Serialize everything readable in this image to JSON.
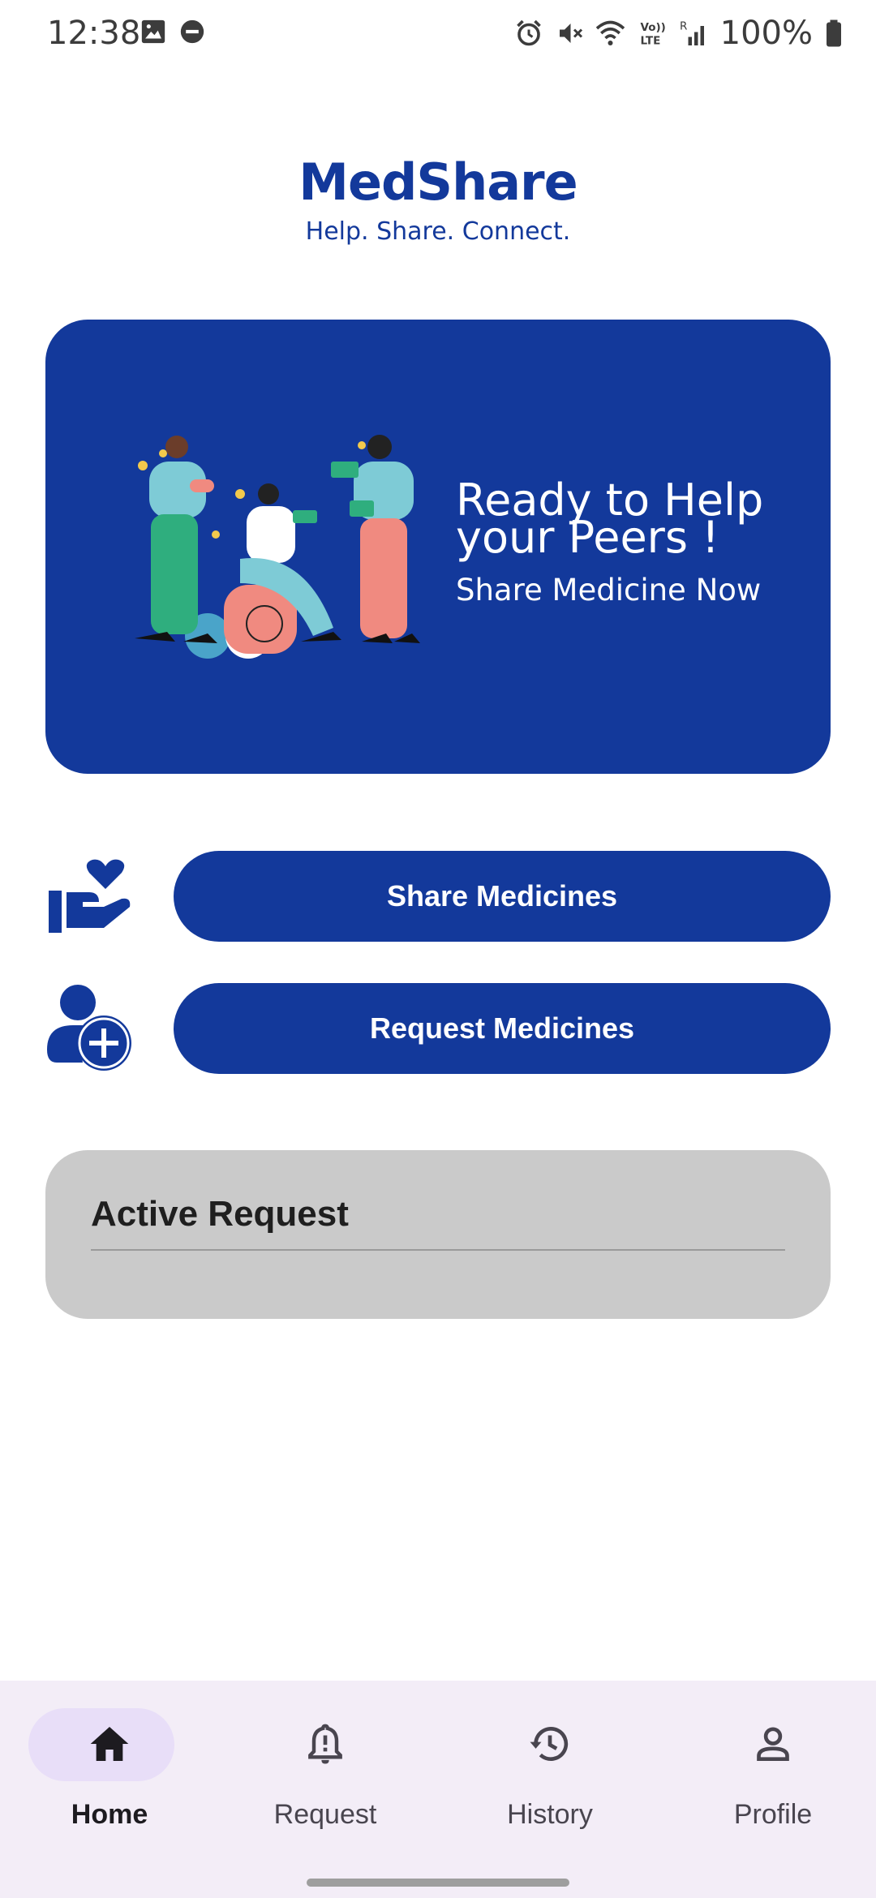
{
  "status_bar": {
    "time": "12:38",
    "battery": "100%",
    "icons": [
      "image-icon",
      "dnd-icon",
      "alarm-icon",
      "mute-icon",
      "wifi-icon",
      "volte-icon",
      "signal-icon",
      "battery-icon"
    ]
  },
  "header": {
    "app_name": "MedShare",
    "tagline": "Help. Share. Connect."
  },
  "hero": {
    "heading": "Ready to Help your Peers !",
    "subheading": "Share Medicine Now",
    "illustration": "people-sharing-money-illustration"
  },
  "actions": {
    "share_label": "Share Medicines",
    "share_icon": "hand-heart-icon",
    "request_label": "Request Medicines",
    "request_icon": "user-plus-icon"
  },
  "active_request": {
    "title": "Active Request"
  },
  "bottom_nav": {
    "items": [
      {
        "label": "Home",
        "icon": "home-icon",
        "active": true
      },
      {
        "label": "Request",
        "icon": "bell-alert-icon",
        "active": false
      },
      {
        "label": "History",
        "icon": "history-icon",
        "active": false
      },
      {
        "label": "Profile",
        "icon": "person-icon",
        "active": false
      }
    ]
  },
  "colors": {
    "primary": "#13399b",
    "card_grey": "#cacaca",
    "nav_bg": "#f3edf7",
    "nav_active_pill": "#e8def8"
  }
}
